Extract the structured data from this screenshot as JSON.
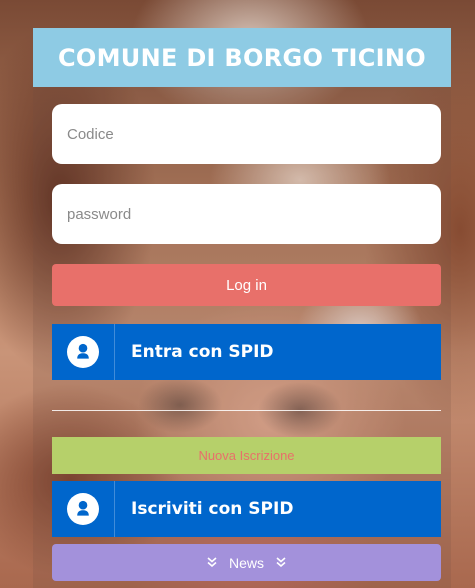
{
  "header": {
    "title": "COMUNE DI BORGO TICINO"
  },
  "login_form": {
    "code_placeholder": "Codice",
    "code_value": "",
    "password_placeholder": "password",
    "password_value": "",
    "login_label": "Log in"
  },
  "spid_login": {
    "label": "Entra con SPID",
    "icon": "user-circle-icon"
  },
  "registration": {
    "new_label": "Nuova Iscrizione"
  },
  "spid_register": {
    "label": "Iscriviti con SPID",
    "icon": "user-circle-icon"
  },
  "news": {
    "label": "News",
    "icon": "double-chevron-down-icon"
  },
  "colors": {
    "title_bar": "#8ecbe4",
    "login_button": "#e8706a",
    "spid_blue": "#0066cc",
    "new_registration": "#b6d06a",
    "news_button": "#a391db"
  }
}
